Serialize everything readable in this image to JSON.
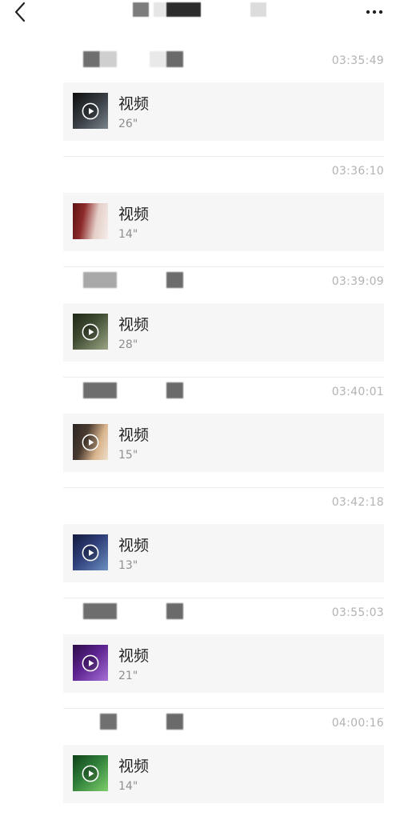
{
  "header": {
    "back_icon": "chevron-left-icon",
    "more_icon": "more-dots-icon"
  },
  "messages": [
    {
      "time": "03:35:49",
      "title": "视频",
      "duration": "26\"",
      "thumb_colors": [
        "#1a1a1a",
        "#606870"
      ]
    },
    {
      "time": "03:36:10",
      "title": "视频",
      "duration": "14\"",
      "thumb_colors": [
        "#7a1b1b",
        "#e8d5d0"
      ]
    },
    {
      "time": "03:39:09",
      "title": "视频",
      "duration": "28\"",
      "thumb_colors": [
        "#2e3a23",
        "#8d9a78"
      ]
    },
    {
      "time": "03:40:01",
      "title": "视频",
      "duration": "15\"",
      "thumb_colors": [
        "#2a2522",
        "#d9b58d"
      ]
    },
    {
      "time": "03:42:18",
      "title": "视频",
      "duration": "13\"",
      "thumb_colors": [
        "#1e2a5a",
        "#4a6c9e"
      ]
    },
    {
      "time": "03:55:03",
      "title": "视频",
      "duration": "21\"",
      "thumb_colors": [
        "#4b1a6e",
        "#9a55c6"
      ]
    },
    {
      "time": "04:00:16",
      "title": "视频",
      "duration": "14\"",
      "thumb_colors": [
        "#1e5e2a",
        "#6abf5f"
      ]
    }
  ]
}
